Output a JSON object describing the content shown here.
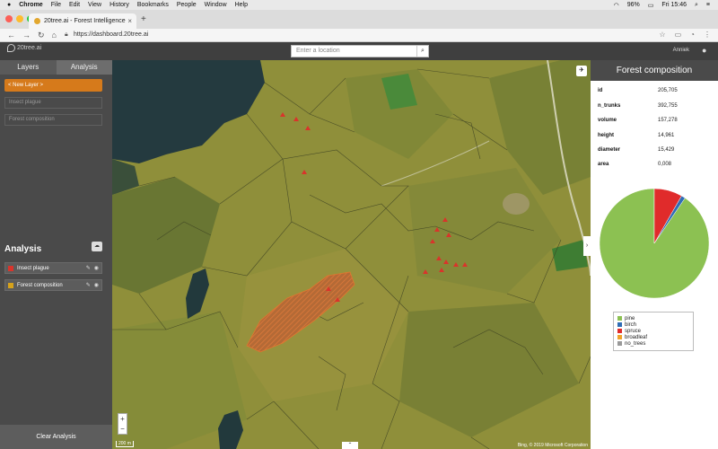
{
  "macos_menu": {
    "app_name": "Chrome",
    "items": [
      "File",
      "Edit",
      "View",
      "History",
      "Bookmarks",
      "People",
      "Window",
      "Help"
    ],
    "battery": "96%",
    "clock": "Fri 15:46"
  },
  "browser": {
    "tab_title": "20tree.ai - Forest Intelligence",
    "url": "https://dashboard.20tree.ai"
  },
  "app": {
    "logo_text": "20tree.ai",
    "search_placeholder": "Enter a location",
    "user_name": "Anniek"
  },
  "sidebar": {
    "tabs": [
      "Layers",
      "Analysis"
    ],
    "new_layer_label": "< New Layer >",
    "inputs": [
      {
        "placeholder": "Insect plague"
      },
      {
        "placeholder": "Forest composition"
      }
    ],
    "analysis_title": "Analysis",
    "layers": [
      {
        "label": "Insect plague",
        "color": "#d9342b"
      },
      {
        "label": "Forest composition",
        "color": "#d6a21b"
      }
    ],
    "clear_label": "Clear Analysis"
  },
  "map": {
    "scale_label": "200 m",
    "attribution": "Bing, © 2019 Microsoft Corporation"
  },
  "panel": {
    "title": "Forest composition",
    "properties": [
      {
        "key": "id",
        "value": "205,705"
      },
      {
        "key": "n_trunks",
        "value": "392,755"
      },
      {
        "key": "volume",
        "value": "157,278"
      },
      {
        "key": "height",
        "value": "14,961"
      },
      {
        "key": "diameter",
        "value": "15,429"
      },
      {
        "key": "area",
        "value": "0,008"
      }
    ],
    "legend": [
      {
        "label": "pine",
        "color": "#8cc152"
      },
      {
        "label": "birch",
        "color": "#2f6db5"
      },
      {
        "label": "spruce",
        "color": "#e02b2b"
      },
      {
        "label": "broadleaf",
        "color": "#f0a32a"
      },
      {
        "label": "no_trees",
        "color": "#999999"
      }
    ]
  },
  "chart_data": {
    "type": "pie",
    "categories": [
      "pine",
      "birch",
      "spruce",
      "broadleaf",
      "no_trees"
    ],
    "values": [
      0.905,
      0.012,
      0.083,
      0.0,
      0.0
    ],
    "colors": [
      "#8cc152",
      "#2f6db5",
      "#e02b2b",
      "#f0a32a",
      "#999999"
    ]
  }
}
